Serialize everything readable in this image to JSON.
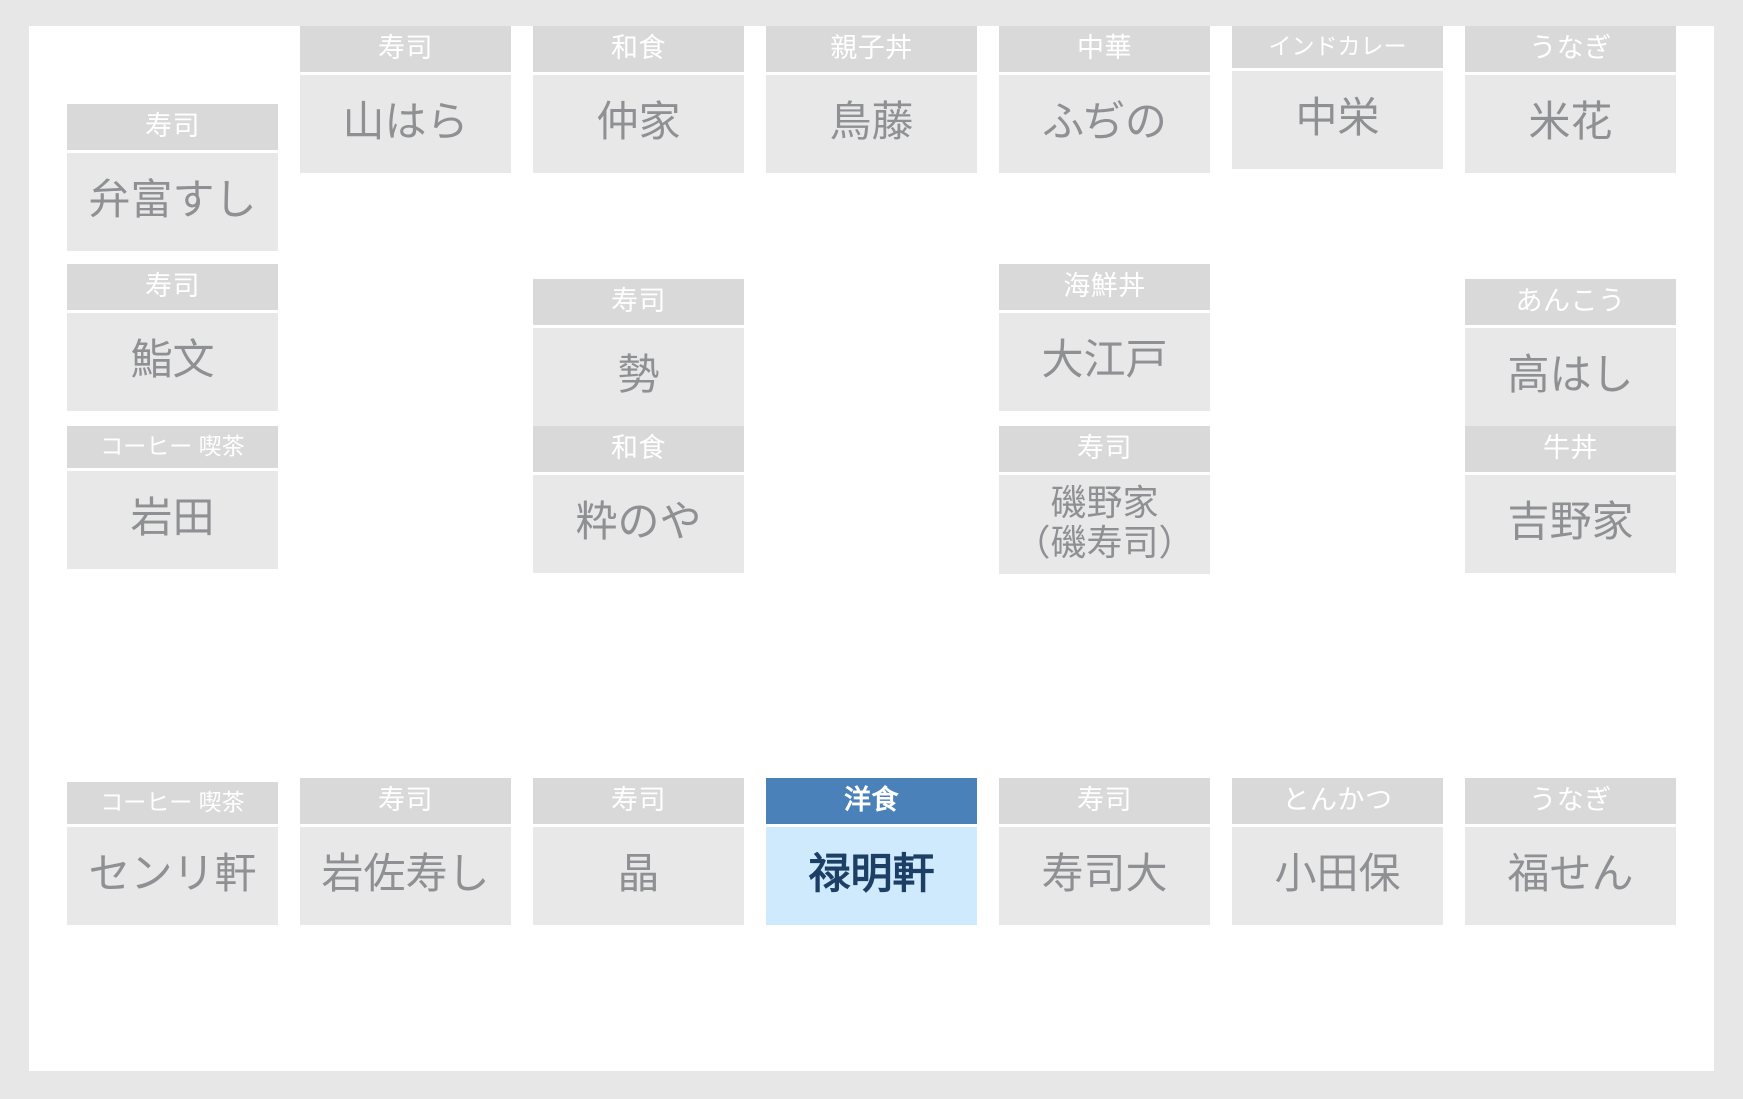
{
  "board": {
    "background_color": "#ffffff",
    "page_background_color": "#e7e7e7",
    "header_color": "#d9d9d9",
    "body_color": "#e8e8e8",
    "selected_header_color": "#4a81b8",
    "selected_body_color": "#cfeafd",
    "selected_text_color": "#1d3f66"
  },
  "cards": {
    "r1c2": {
      "genre": "寿司",
      "name": "山はら"
    },
    "r1c3": {
      "genre": "和食",
      "name": "仲家"
    },
    "r1c4": {
      "genre": "親子丼",
      "name": "鳥藤"
    },
    "r1c5": {
      "genre": "中華",
      "name": "ふぢの"
    },
    "r1c6": {
      "genre": "インドカレー",
      "name": "中栄"
    },
    "r1c7": {
      "genre": "うなぎ",
      "name": "米花"
    },
    "r2c1": {
      "genre": "寿司",
      "name": "弁富すし"
    },
    "r3c1": {
      "genre": "寿司",
      "name": "鮨文"
    },
    "r4c1": {
      "genre": "コーヒー 喫茶",
      "name": "岩田"
    },
    "r3c3": {
      "genre": "寿司",
      "name": "勢"
    },
    "r4c3": {
      "genre": "和食",
      "name": "粋のや"
    },
    "r3c5": {
      "genre": "海鮮丼",
      "name": "大江戸"
    },
    "r4c5": {
      "genre": "寿司",
      "name": "磯野家\n（磯寿司）"
    },
    "r3c7": {
      "genre": "あんこう",
      "name": "高はし"
    },
    "r4c7": {
      "genre": "牛丼",
      "name": "吉野家"
    },
    "r5c1": {
      "genre": "コーヒー 喫茶",
      "name": "センリ軒"
    },
    "r5c2": {
      "genre": "寿司",
      "name": "岩佐寿し"
    },
    "r5c3": {
      "genre": "寿司",
      "name": "晶"
    },
    "r5c4": {
      "genre": "洋食",
      "name": "禄明軒",
      "selected": true
    },
    "r5c5": {
      "genre": "寿司",
      "name": "寿司大"
    },
    "r5c6": {
      "genre": "とんかつ",
      "name": "小田保"
    },
    "r5c7": {
      "genre": "うなぎ",
      "name": "福せん"
    }
  }
}
